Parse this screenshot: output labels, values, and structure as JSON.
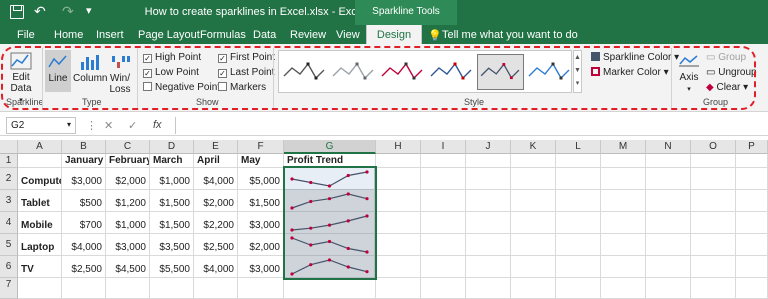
{
  "title_bar": {
    "document_title": "How to create sparklines in Excel.xlsx  -  Excel",
    "context_label": "Sparkline Tools"
  },
  "tabs": [
    "File",
    "Home",
    "Insert",
    "Page Layout",
    "Formulas",
    "Data",
    "Review",
    "View",
    "Design"
  ],
  "active_tab": "Design",
  "tell_me": "Tell me what you want to do",
  "ribbon": {
    "sparkline_group": {
      "label": "Sparkline",
      "edit_data": "Edit Data"
    },
    "type_group": {
      "label": "Type",
      "line": "Line",
      "column": "Column",
      "winloss": "Win/ Loss"
    },
    "show_group": {
      "label": "Show",
      "high_point": "High Point",
      "low_point": "Low Point",
      "negative_points": "Negative Points",
      "first_point": "First Point",
      "last_point": "Last Point",
      "markers": "Markers",
      "checked": {
        "high_point": true,
        "low_point": true,
        "negative_points": false,
        "first_point": true,
        "last_point": true,
        "markers": false
      }
    },
    "style_group": {
      "label": "Style",
      "sparkline_color": "Sparkline Color",
      "marker_color": "Marker Color"
    },
    "group_group": {
      "label": "Group",
      "axis": "Axis",
      "group": "Group",
      "ungroup": "Ungroup",
      "clear": "Clear"
    }
  },
  "formula_bar": {
    "name_box": "G2",
    "fx": "fx",
    "formula": ""
  },
  "columns": [
    "A",
    "B",
    "C",
    "D",
    "E",
    "F",
    "G",
    "H",
    "I",
    "J",
    "K",
    "L",
    "M",
    "N",
    "O",
    "P"
  ],
  "selected_column": "G",
  "rows": [
    "1",
    "2",
    "3",
    "4",
    "5",
    "6",
    "7"
  ],
  "table": {
    "headers": [
      "",
      "January",
      "February",
      "March",
      "April",
      "May",
      "Profit Trend"
    ],
    "data": [
      {
        "label": "Computer",
        "values": [
          "$3,000",
          "$2,000",
          "$1,000",
          "$4,000",
          "$5,000"
        ]
      },
      {
        "label": "Tablet",
        "values": [
          "$500",
          "$1,200",
          "$1,500",
          "$2,000",
          "$1,500"
        ]
      },
      {
        "label": "Mobile",
        "values": [
          "$700",
          "$1,000",
          "$1,500",
          "$2,200",
          "$3,000"
        ]
      },
      {
        "label": "Laptop",
        "values": [
          "$4,000",
          "$3,000",
          "$3,500",
          "$2,500",
          "$2,000"
        ]
      },
      {
        "label": "TV",
        "values": [
          "$2,500",
          "$4,500",
          "$5,500",
          "$4,000",
          "$3,000"
        ]
      }
    ]
  },
  "sparkline_values": [
    [
      3000,
      2000,
      1000,
      4000,
      5000
    ],
    [
      500,
      1200,
      1500,
      2000,
      1500
    ],
    [
      700,
      1000,
      1500,
      2200,
      3000
    ],
    [
      4000,
      3000,
      3500,
      2500,
      2000
    ],
    [
      2500,
      4500,
      5500,
      4000,
      3000
    ]
  ],
  "colors": {
    "excel_green": "#217346",
    "highlight_dashes": "#e21f26",
    "sparkline_line": "#44546a",
    "marker": "#c0003a"
  }
}
